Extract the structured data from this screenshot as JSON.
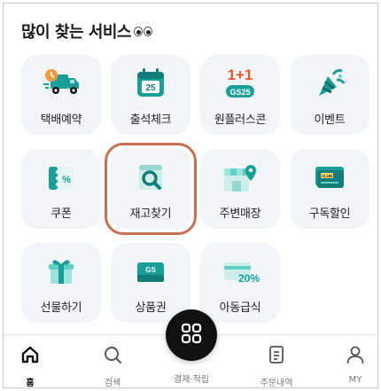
{
  "section": {
    "title": "많이 찾는 서비스"
  },
  "services": [
    {
      "label": "택배예약",
      "icon": "delivery-truck-icon"
    },
    {
      "label": "출석체크",
      "icon": "calendar-25-icon",
      "icon_text": "25"
    },
    {
      "label": "원플러스콘",
      "icon": "one-plus-one-gs25-icon",
      "icon_text_top": "1+1",
      "icon_text_badge": "GS25"
    },
    {
      "label": "이벤트",
      "icon": "party-popper-icon"
    },
    {
      "label": "쿠폰",
      "icon": "coupon-icon",
      "icon_text": "%"
    },
    {
      "label": "재고찾기",
      "icon": "stock-search-icon"
    },
    {
      "label": "주변매장",
      "icon": "nearby-store-icon"
    },
    {
      "label": "구독할인",
      "icon": "subscription-card-icon",
      "icon_text": "CLUB"
    },
    {
      "label": "선물하기",
      "icon": "gift-box-icon"
    },
    {
      "label": "상품권",
      "icon": "gift-voucher-icon",
      "icon_text": "GS"
    },
    {
      "label": "아동급식",
      "icon": "child-meal-card-icon",
      "icon_text": "20%"
    }
  ],
  "tabs": [
    {
      "label": "홈",
      "icon": "home-icon",
      "active": true
    },
    {
      "label": "검색",
      "icon": "search-icon"
    },
    {
      "label": "결제·적립",
      "icon": "pay-qr-icon"
    },
    {
      "label": "주문내역",
      "icon": "order-list-icon"
    },
    {
      "label": "MY",
      "icon": "user-icon"
    }
  ],
  "colors": {
    "teal": "#1a9e9a",
    "light_teal": "#5fd1c4",
    "orange": "#f39a3a",
    "highlight": "#c8704f",
    "tile_bg": "#f3f6f9"
  }
}
